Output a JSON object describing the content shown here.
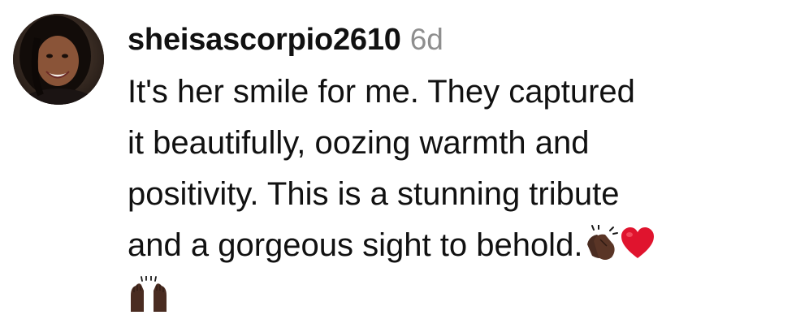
{
  "comment": {
    "username": "sheisascorpio2610",
    "time": "6d",
    "lines": [
      "It's her smile for me. They captured",
      "it beautifully, oozing warmth and",
      "positivity. This is a stunning tribute",
      "and a gorgeous sight to behold."
    ],
    "emojis": {
      "clap": "clapping-hands-emoji",
      "heart": "red-heart-emoji",
      "raised": "raising-hands-emoji"
    }
  },
  "colors": {
    "text": "#111111",
    "muted": "#8e8e8e",
    "heart": "#e0142e",
    "skin": "#4a2c21"
  }
}
